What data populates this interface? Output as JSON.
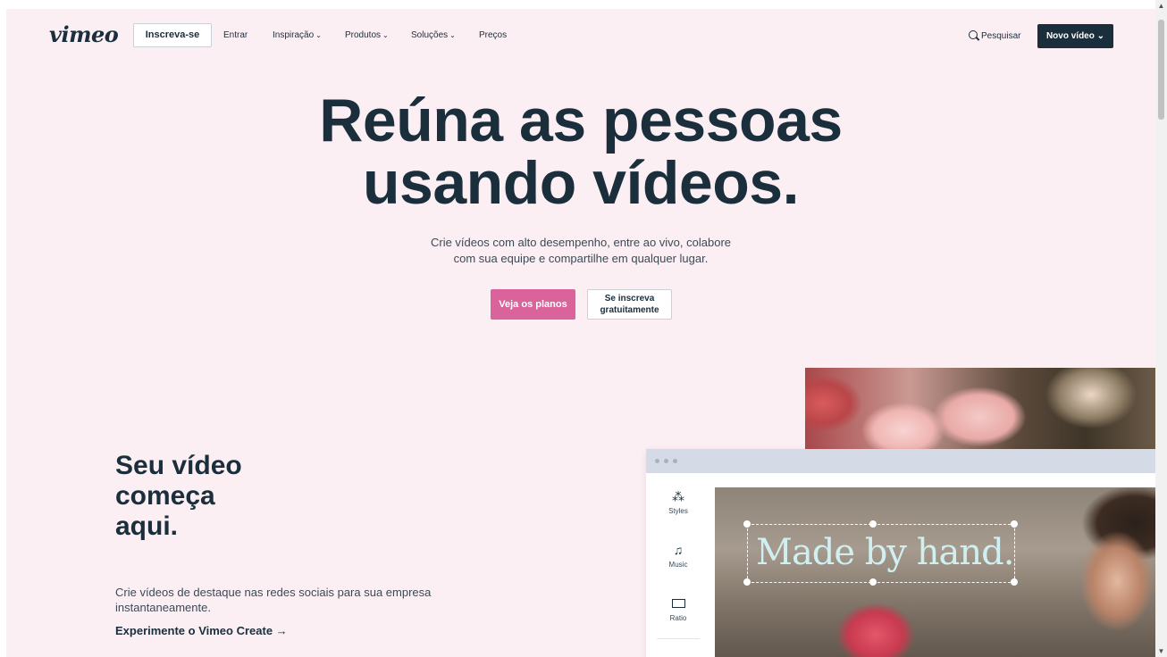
{
  "nav": {
    "logo": "vimeo",
    "signup_label": "Inscreva-se",
    "login_label": "Entrar",
    "links": [
      "Inspiração",
      "Produtos",
      "Soluções",
      "Preços"
    ],
    "search_label": "Pesquisar",
    "new_video_label": "Novo vídeo"
  },
  "hero": {
    "title_line1": "Reúna as pessoas",
    "title_line2": "usando vídeos.",
    "subtitle_line1": "Crie vídeos com alto desempenho, entre ao vivo, colabore",
    "subtitle_line2": "com sua equipe e compartilhe em qualquer lugar.",
    "plans_button": "Veja os planos",
    "free_button_line1": "Se inscreva",
    "free_button_line2": "gratuitamente"
  },
  "section": {
    "title_line1": "Seu vídeo",
    "title_line2": "começa",
    "title_line3": "aqui.",
    "description": "Crie vídeos de destaque nas redes sociais para sua empresa instantaneamente.",
    "cta": "Experimente o Vimeo Create →"
  },
  "editor": {
    "tools": [
      {
        "label": "Styles",
        "icon": "magic-wand-icon"
      },
      {
        "label": "Music",
        "icon": "music-note-icon"
      },
      {
        "label": "Ratio",
        "icon": "ratio-icon"
      }
    ],
    "video_text": "Made by hand."
  },
  "colors": {
    "page_bg": "#fbeff4",
    "text_dark": "#1a2e3b",
    "accent_pink": "#d9639a"
  }
}
